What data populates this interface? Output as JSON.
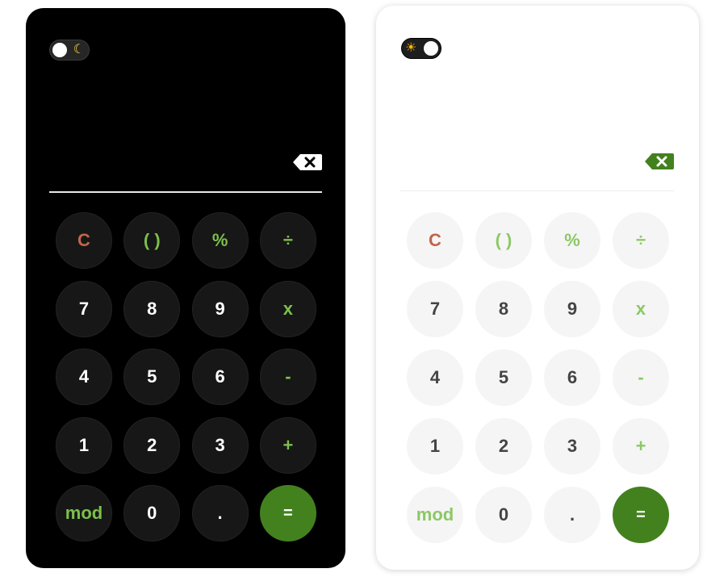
{
  "calculators": [
    {
      "theme": "dark",
      "toggle_icon": "moon-icon",
      "toggle_glyph": "☾",
      "rows": [
        [
          {
            "label": "C",
            "kind": "red"
          },
          {
            "label": "( )",
            "kind": "green"
          },
          {
            "label": "%",
            "kind": "green"
          },
          {
            "label": "÷",
            "kind": "green"
          }
        ],
        [
          {
            "label": "7",
            "kind": "num"
          },
          {
            "label": "8",
            "kind": "num"
          },
          {
            "label": "9",
            "kind": "num"
          },
          {
            "label": "x",
            "kind": "green"
          }
        ],
        [
          {
            "label": "4",
            "kind": "num"
          },
          {
            "label": "5",
            "kind": "num"
          },
          {
            "label": "6",
            "kind": "num"
          },
          {
            "label": "-",
            "kind": "green"
          }
        ],
        [
          {
            "label": "1",
            "kind": "num"
          },
          {
            "label": "2",
            "kind": "num"
          },
          {
            "label": "3",
            "kind": "num"
          },
          {
            "label": "+",
            "kind": "green"
          }
        ],
        [
          {
            "label": "mod",
            "kind": "green"
          },
          {
            "label": "0",
            "kind": "num"
          },
          {
            "label": ".",
            "kind": "num"
          },
          {
            "label": "=",
            "kind": "equals"
          }
        ]
      ]
    },
    {
      "theme": "light",
      "toggle_icon": "sun-icon",
      "toggle_glyph": "☀",
      "rows": [
        [
          {
            "label": "C",
            "kind": "red"
          },
          {
            "label": "( )",
            "kind": "green"
          },
          {
            "label": "%",
            "kind": "green"
          },
          {
            "label": "÷",
            "kind": "green"
          }
        ],
        [
          {
            "label": "7",
            "kind": "num"
          },
          {
            "label": "8",
            "kind": "num"
          },
          {
            "label": "9",
            "kind": "num"
          },
          {
            "label": "x",
            "kind": "green"
          }
        ],
        [
          {
            "label": "4",
            "kind": "num"
          },
          {
            "label": "5",
            "kind": "num"
          },
          {
            "label": "6",
            "kind": "num"
          },
          {
            "label": "-",
            "kind": "green"
          }
        ],
        [
          {
            "label": "1",
            "kind": "num"
          },
          {
            "label": "2",
            "kind": "num"
          },
          {
            "label": "3",
            "kind": "num"
          },
          {
            "label": "+",
            "kind": "green"
          }
        ],
        [
          {
            "label": "mod",
            "kind": "green"
          },
          {
            "label": "0",
            "kind": "num"
          },
          {
            "label": ".",
            "kind": "num"
          },
          {
            "label": "=",
            "kind": "equals"
          }
        ]
      ]
    }
  ],
  "colors": {
    "accent_green": "#43811f",
    "operator_green": "#7cc04b",
    "clear_red": "#c0654d"
  }
}
